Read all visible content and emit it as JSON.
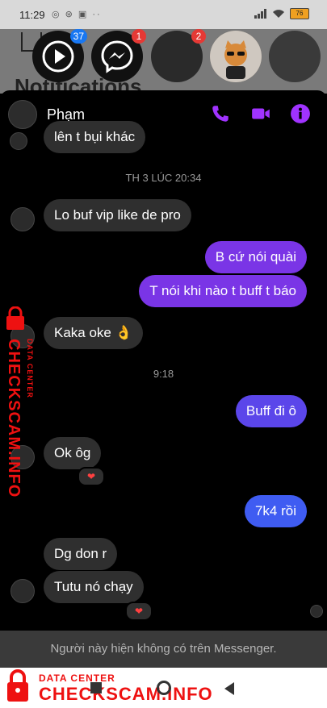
{
  "status_bar": {
    "time": "11:29",
    "notification_icons": "◎ ⊛ ▣ ··",
    "battery": "76"
  },
  "background_app": {
    "title": "Notifications"
  },
  "chat_heads": [
    {
      "badge": "37",
      "badge_color": "#1877f2"
    },
    {
      "badge": "1",
      "badge_color": "#e53935"
    },
    {
      "badge": "2",
      "badge_color": "#e53935"
    },
    {
      "badge": "",
      "badge_color": ""
    },
    {
      "badge": "",
      "badge_color": ""
    }
  ],
  "chat": {
    "contact_name": "Phạm",
    "accent_color": "#a033ff",
    "messages": {
      "m0": "lên t bụi khác",
      "ts1": "TH 3 LÚC 20:34",
      "m1": "Lo buf vip like de pro",
      "m2": "B cứ nói quài",
      "m3": "T nói khi nào t buff t báo",
      "m4": "Kaka oke 👌",
      "ts2": "9:18",
      "m5": "Buff đi ô",
      "m6": "Ok ôg",
      "m6_reaction": "❤",
      "m7": "7k4 rồi",
      "m8": "Dg don r",
      "m9": "Tutu nó chạy",
      "m9_reaction": "❤"
    },
    "footer_note": "Người này hiện không có trên Messenger."
  },
  "watermark": {
    "small": "DATA CENTER",
    "big": "CHECKSCAM.INFO"
  }
}
